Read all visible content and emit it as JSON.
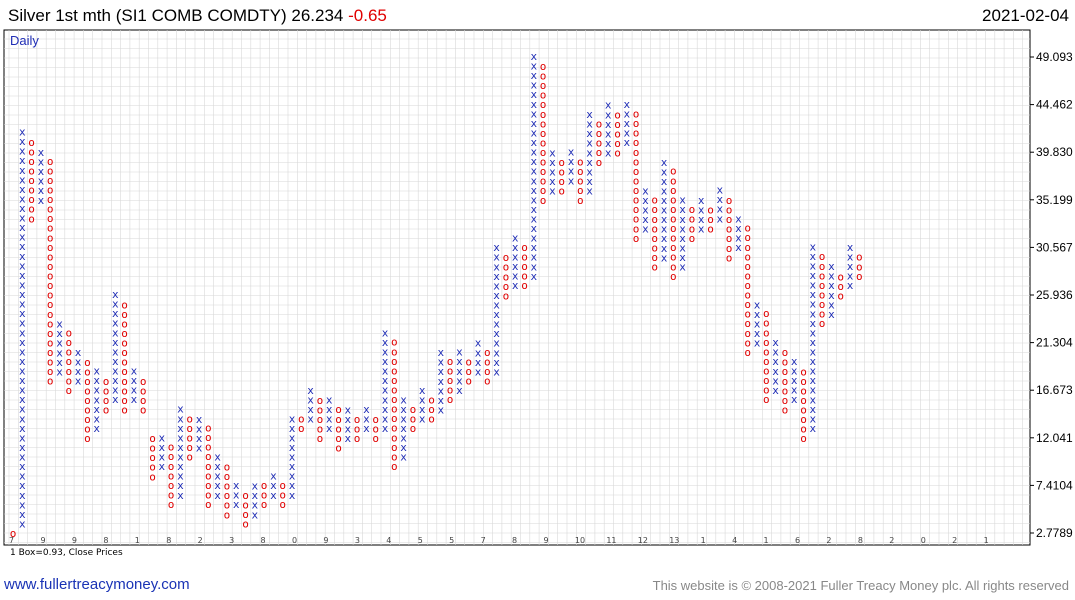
{
  "header": {
    "title": "Silver 1st mth (SI1 COMB COMDTY) 26.234",
    "change": "-0.65",
    "date": "2021-02-04",
    "change_color": "#e00000"
  },
  "chart_data": {
    "type": "point-and-figure",
    "period_label": "Daily",
    "box_note": "1 Box=0.93, Close Prices",
    "y_ticks": [
      "49.093",
      "44.462",
      "39.830",
      "35.199",
      "30.567",
      "25.936",
      "21.304",
      "16.673",
      "12.041",
      "7.4104",
      "2.7789"
    ],
    "x_labels": [
      "7",
      "9",
      "9",
      "8",
      "1",
      "8",
      "2",
      "3",
      "8",
      "0",
      "9",
      "3",
      "4",
      "5",
      "5",
      "7",
      "8",
      "9",
      "10",
      "11",
      "12",
      "13",
      "1",
      "4",
      "1",
      "6",
      "2",
      "8",
      "2",
      "0",
      "2",
      "1"
    ],
    "ylim": [
      2.7789,
      49.093
    ],
    "box_size": 0.93,
    "colors": {
      "x": "#1f2db5",
      "o": "#e00000",
      "grid": "#d8d8d8"
    },
    "columns": [
      {
        "type": "O",
        "low": 2.78,
        "high": 2.78
      },
      {
        "type": "X",
        "low": 3.71,
        "high": 42.3
      },
      {
        "type": "O",
        "low": 33.4,
        "high": 41.3
      },
      {
        "type": "X",
        "low": 35.2,
        "high": 39.8
      },
      {
        "type": "O",
        "low": 17.6,
        "high": 38.9
      },
      {
        "type": "X",
        "low": 18.5,
        "high": 23.2
      },
      {
        "type": "O",
        "low": 16.7,
        "high": 22.2
      },
      {
        "type": "X",
        "low": 17.6,
        "high": 20.4
      },
      {
        "type": "O",
        "low": 12.0,
        "high": 19.5
      },
      {
        "type": "X",
        "low": 13.0,
        "high": 18.5
      },
      {
        "type": "O",
        "low": 14.8,
        "high": 17.6
      },
      {
        "type": "X",
        "low": 15.8,
        "high": 25.9
      },
      {
        "type": "O",
        "low": 14.8,
        "high": 25.0
      },
      {
        "type": "X",
        "low": 15.8,
        "high": 18.5
      },
      {
        "type": "O",
        "low": 14.8,
        "high": 17.6
      },
      {
        "type": "O",
        "low": 8.3,
        "high": 12.0
      },
      {
        "type": "X",
        "low": 9.3,
        "high": 12.0
      },
      {
        "type": "O",
        "low": 5.6,
        "high": 11.1
      },
      {
        "type": "X",
        "low": 6.5,
        "high": 14.8
      },
      {
        "type": "O",
        "low": 10.2,
        "high": 13.9
      },
      {
        "type": "X",
        "low": 11.1,
        "high": 13.9
      },
      {
        "type": "O",
        "low": 5.6,
        "high": 13.0
      },
      {
        "type": "X",
        "low": 6.5,
        "high": 10.2
      },
      {
        "type": "O",
        "low": 4.6,
        "high": 9.3
      },
      {
        "type": "X",
        "low": 5.6,
        "high": 7.4
      },
      {
        "type": "O",
        "low": 3.7,
        "high": 6.5
      },
      {
        "type": "X",
        "low": 4.6,
        "high": 7.4
      },
      {
        "type": "O",
        "low": 5.6,
        "high": 7.4
      },
      {
        "type": "X",
        "low": 6.5,
        "high": 8.3
      },
      {
        "type": "O",
        "low": 5.6,
        "high": 7.4
      },
      {
        "type": "X",
        "low": 6.5,
        "high": 13.9
      },
      {
        "type": "O",
        "low": 13.0,
        "high": 13.9
      },
      {
        "type": "X",
        "low": 13.9,
        "high": 16.7
      },
      {
        "type": "O",
        "low": 12.0,
        "high": 15.8
      },
      {
        "type": "X",
        "low": 13.0,
        "high": 15.8
      },
      {
        "type": "O",
        "low": 11.1,
        "high": 14.8
      },
      {
        "type": "X",
        "low": 12.0,
        "high": 14.8
      },
      {
        "type": "O",
        "low": 12.0,
        "high": 13.9
      },
      {
        "type": "X",
        "low": 13.0,
        "high": 14.8
      },
      {
        "type": "O",
        "low": 12.0,
        "high": 13.9
      },
      {
        "type": "X",
        "low": 13.0,
        "high": 22.2
      },
      {
        "type": "O",
        "low": 9.3,
        "high": 21.3
      },
      {
        "type": "X",
        "low": 10.2,
        "high": 15.8
      },
      {
        "type": "O",
        "low": 13.0,
        "high": 14.8
      },
      {
        "type": "X",
        "low": 13.9,
        "high": 16.7
      },
      {
        "type": "O",
        "low": 13.9,
        "high": 15.8
      },
      {
        "type": "X",
        "low": 14.8,
        "high": 20.4
      },
      {
        "type": "O",
        "low": 15.8,
        "high": 19.5
      },
      {
        "type": "X",
        "low": 16.7,
        "high": 20.4
      },
      {
        "type": "O",
        "low": 17.6,
        "high": 19.5
      },
      {
        "type": "X",
        "low": 18.5,
        "high": 21.3
      },
      {
        "type": "O",
        "low": 17.6,
        "high": 20.4
      },
      {
        "type": "X",
        "low": 18.5,
        "high": 30.6
      },
      {
        "type": "O",
        "low": 25.9,
        "high": 29.6
      },
      {
        "type": "X",
        "low": 26.9,
        "high": 31.5
      },
      {
        "type": "O",
        "low": 26.9,
        "high": 30.6
      },
      {
        "type": "X",
        "low": 27.8,
        "high": 49.1
      },
      {
        "type": "O",
        "low": 35.2,
        "high": 48.2
      },
      {
        "type": "X",
        "low": 36.1,
        "high": 39.8
      },
      {
        "type": "O",
        "low": 36.1,
        "high": 38.9
      },
      {
        "type": "X",
        "low": 37.1,
        "high": 39.8
      },
      {
        "type": "O",
        "low": 35.2,
        "high": 38.9
      },
      {
        "type": "X",
        "low": 36.1,
        "high": 43.5
      },
      {
        "type": "O",
        "low": 38.9,
        "high": 42.6
      },
      {
        "type": "X",
        "low": 39.8,
        "high": 44.5
      },
      {
        "type": "O",
        "low": 39.8,
        "high": 43.5
      },
      {
        "type": "X",
        "low": 40.8,
        "high": 44.5
      },
      {
        "type": "O",
        "low": 31.5,
        "high": 43.5
      },
      {
        "type": "X",
        "low": 32.4,
        "high": 36.1
      },
      {
        "type": "O",
        "low": 28.7,
        "high": 35.2
      },
      {
        "type": "X",
        "low": 29.6,
        "high": 38.9
      },
      {
        "type": "O",
        "low": 27.8,
        "high": 38.0
      },
      {
        "type": "X",
        "low": 28.7,
        "high": 35.2
      },
      {
        "type": "O",
        "low": 31.5,
        "high": 34.3
      },
      {
        "type": "X",
        "low": 32.4,
        "high": 35.2
      },
      {
        "type": "O",
        "low": 32.4,
        "high": 34.3
      },
      {
        "type": "X",
        "low": 33.4,
        "high": 36.1
      },
      {
        "type": "O",
        "low": 29.6,
        "high": 35.2
      },
      {
        "type": "X",
        "low": 30.6,
        "high": 33.4
      },
      {
        "type": "O",
        "low": 20.4,
        "high": 32.4
      },
      {
        "type": "X",
        "low": 21.3,
        "high": 25.0
      },
      {
        "type": "O",
        "low": 15.8,
        "high": 24.1
      },
      {
        "type": "X",
        "low": 16.7,
        "high": 21.3
      },
      {
        "type": "O",
        "low": 14.8,
        "high": 20.4
      },
      {
        "type": "X",
        "low": 15.8,
        "high": 19.5
      },
      {
        "type": "O",
        "low": 12.0,
        "high": 18.5
      },
      {
        "type": "X",
        "low": 13.0,
        "high": 30.6
      },
      {
        "type": "O",
        "low": 23.2,
        "high": 29.6
      },
      {
        "type": "X",
        "low": 24.1,
        "high": 28.7
      },
      {
        "type": "O",
        "low": 25.9,
        "high": 27.8
      },
      {
        "type": "X",
        "low": 26.9,
        "high": 30.6
      },
      {
        "type": "O",
        "low": 27.8,
        "high": 29.6
      }
    ]
  },
  "footer": {
    "link": "www.fullertreacymoney.com",
    "copyright": "This website is © 2008-2021 Fuller Treacy Money plc. All rights reserved"
  }
}
